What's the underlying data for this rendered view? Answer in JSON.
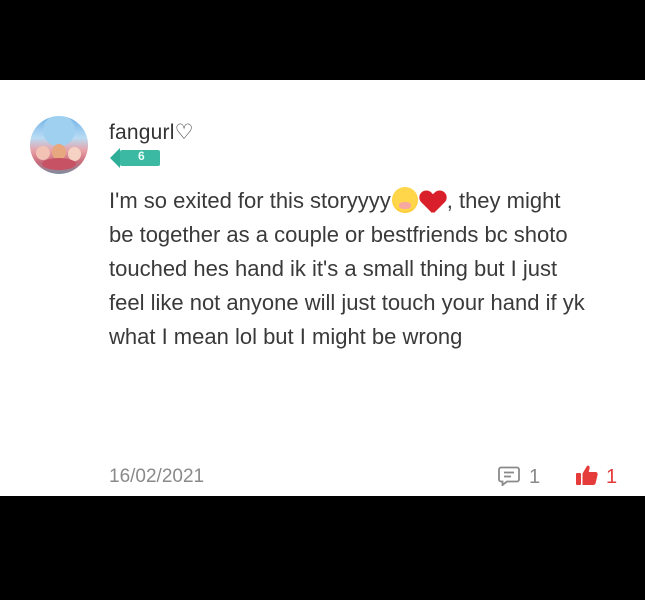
{
  "post": {
    "username": "fangurl♡",
    "level": "6",
    "comment_lines": {
      "line1_start": "I'm so exited for this storyyyy",
      "line1_end": ", they might",
      "line2": "be together as a couple or bestfriends bc shoto",
      "line3": "touched hes hand ik it's a small thing but I just",
      "line4": "feel like not anyone will just touch your hand if yk",
      "line5": "what I mean lol but I might be wrong"
    },
    "emojis": [
      "hand-over-mouth-face-emoji",
      "red-heart-emoji"
    ],
    "date": "16/02/2021",
    "comment_count": "1",
    "like_count": "1"
  },
  "colors": {
    "background": "#000000",
    "card": "#ffffff",
    "badge": "#3cb9a3",
    "like": "#e53b3b",
    "muted_text": "#8a8a8a"
  }
}
